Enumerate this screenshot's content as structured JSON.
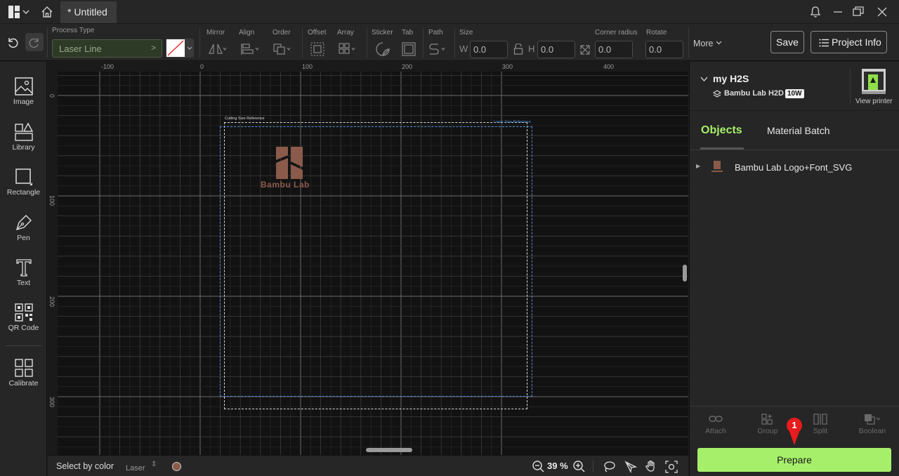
{
  "titlebar": {
    "tab_title": "* Untitled"
  },
  "toolbar": {
    "process_type_label": "Process Type",
    "process_type_value": "Laser Line",
    "mirror_label": "Mirror",
    "align_label": "Align",
    "order_label": "Order",
    "offset_label": "Offset",
    "array_label": "Array",
    "sticker_label": "Sticker",
    "tab_label": "Tab",
    "path_label": "Path",
    "size_label": "Size",
    "w_label": "W",
    "w_value": "0.0",
    "h_label": "H",
    "h_value": "0.0",
    "corner_radius_label": "Corner radius",
    "corner_radius_value": "0.0",
    "rotate_label": "Rotate",
    "rotate_value": "0.0",
    "more_label": "More",
    "save_label": "Save",
    "project_info_label": "Project Info"
  },
  "sidebar": {
    "items": [
      {
        "label": "Image"
      },
      {
        "label": "Library"
      },
      {
        "label": "Rectangle"
      },
      {
        "label": "Pen"
      },
      {
        "label": "Text"
      },
      {
        "label": "QR Code"
      },
      {
        "label": "Calibrate"
      }
    ]
  },
  "canvas": {
    "ruler_x_labels": [
      "-100",
      "0",
      "100",
      "200",
      "300",
      "400"
    ],
    "ruler_y_labels": [
      "0",
      "100",
      "200",
      "300"
    ],
    "cutting_ref_label": "Cutting Size Reference",
    "laser_ref_label": "Laser Size Reference",
    "logo_text": "Bambu Lab"
  },
  "bottombar": {
    "select_by_color_label": "Select by color",
    "laser_label": "Laser",
    "zoom_level": "39 %"
  },
  "printer": {
    "name": "my H2S",
    "model": "Bambu Lab H2D",
    "power_badge": "10W",
    "view_printer_label": "View printer"
  },
  "right_tabs": {
    "objects": "Objects",
    "material_batch": "Material Batch"
  },
  "objects": [
    {
      "name": "Bambu Lab Logo+Font_SVG"
    }
  ],
  "actions": {
    "attach": "Attach",
    "group": "Group",
    "split": "Split",
    "boolean": "Boolean"
  },
  "prepare_label": "Prepare",
  "marker_badge": "1",
  "colors": {
    "accent": "#a6ef6a",
    "marker": "#e81c1c",
    "logo": "#8a5a4a",
    "laser_ref": "#4a8fd8"
  }
}
